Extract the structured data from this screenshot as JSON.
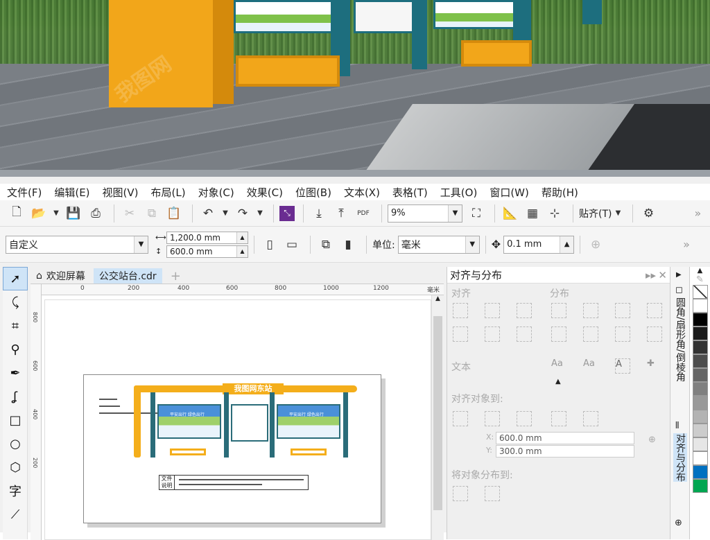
{
  "menu": [
    "文件(F)",
    "编辑(E)",
    "视图(V)",
    "布局(L)",
    "对象(C)",
    "效果(C)",
    "位图(B)",
    "文本(X)",
    "表格(T)",
    "工具(O)",
    "窗口(W)",
    "帮助(H)"
  ],
  "toolbar": {
    "zoom": "9%",
    "pdf_label": "PDF",
    "snap_label": "贴齐(T)",
    "page_preset": "自定义",
    "width": "1,200.0 mm",
    "height": "600.0 mm",
    "units_label": "单位:",
    "units": "毫米",
    "nudge": "0.1 mm",
    "more": "»"
  },
  "tabs": [
    {
      "label": "欢迎屏幕",
      "icon": "home-icon"
    },
    {
      "label": "公交站台.cdr",
      "icon": ""
    }
  ],
  "ruler": {
    "h_ticks": [
      "0",
      "200",
      "400",
      "600",
      "800",
      "1000",
      "1200"
    ],
    "unit": "毫米",
    "v_ticks": [
      "800",
      "600",
      "400",
      "200"
    ]
  },
  "artboard": {
    "sign": "我图网东站",
    "note_line1": "文件",
    "note_line2": "说明",
    "panel_text": "平安出行 绿色出行"
  },
  "dock": {
    "title": "对齐与分布",
    "align_label": "对齐",
    "distribute_label": "分布",
    "text_label": "文本",
    "align_to_label": "对齐对象到:",
    "x_label": "X:",
    "x_value": "600.0 mm",
    "y_label": "Y:",
    "y_value": "300.0 mm",
    "dist_to_label": "将对象分布到:"
  },
  "side_tabs": [
    "圆角/扇形角/倒棱角",
    "对齐与分布"
  ],
  "palette": [
    "#ffffff",
    "#000000",
    "#1a1a1a",
    "#333333",
    "#4d4d4d",
    "#666666",
    "#808080",
    "#999999",
    "#b3b3b3",
    "#cccccc",
    "#e6e6e6",
    "#ffffff",
    "#0070c0",
    "#00a651"
  ],
  "watermark": "我图网"
}
